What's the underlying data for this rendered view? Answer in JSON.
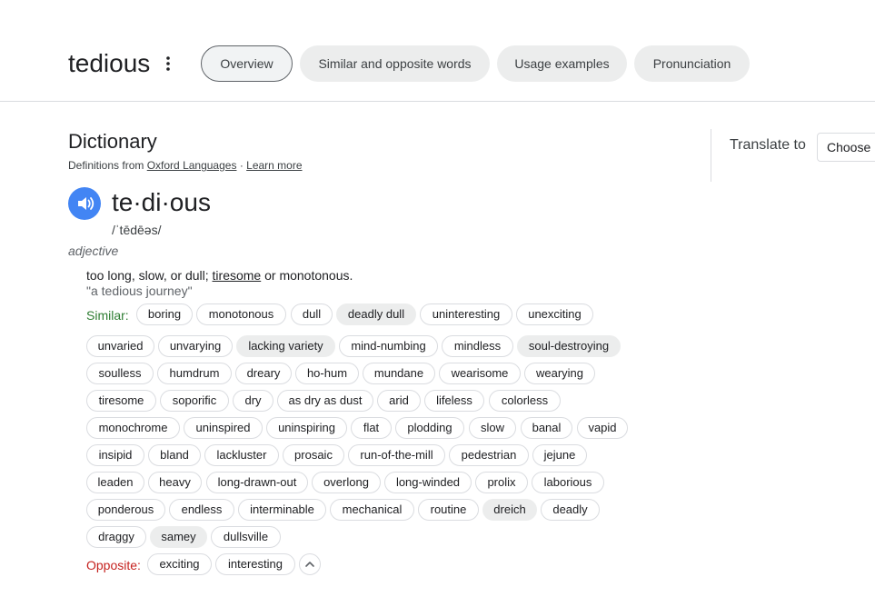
{
  "header": {
    "word": "tedious",
    "tabs": [
      {
        "label": "Overview"
      },
      {
        "label": "Similar and opposite words"
      },
      {
        "label": "Usage examples"
      },
      {
        "label": "Pronunciation"
      }
    ],
    "more_icon": "more-vert-icon"
  },
  "dictionary": {
    "heading": "Dictionary",
    "source_prefix": "Definitions from",
    "source_link": "Oxford Languages",
    "separator": "·",
    "learn_more": "Learn more"
  },
  "translate": {
    "label": "Translate to",
    "select_value": "Choose"
  },
  "entry": {
    "audio_icon": "speaker-icon",
    "headword": "te·di·ous",
    "phonetic": "/ˈtēdēəs/",
    "part_of_speech": "adjective",
    "definition_before": "too long, slow, or dull; ",
    "definition_link": "tiresome",
    "definition_after": " or monotonous.",
    "example": "\"a tedious journey\"",
    "similar_label": "Similar:",
    "similar": [
      {
        "word": "boring"
      },
      {
        "word": "monotonous"
      },
      {
        "word": "dull"
      },
      {
        "word": "deadly dull"
      },
      {
        "word": "uninteresting"
      },
      {
        "word": "unexciting"
      },
      {
        "word": "unvaried"
      },
      {
        "word": "unvarying"
      },
      {
        "word": "lacking variety"
      },
      {
        "word": "mind-numbing"
      },
      {
        "word": "mindless"
      },
      {
        "word": "soul-destroying"
      },
      {
        "word": "soulless"
      },
      {
        "word": "humdrum"
      },
      {
        "word": "dreary"
      },
      {
        "word": "ho-hum"
      },
      {
        "word": "mundane"
      },
      {
        "word": "wearisome"
      },
      {
        "word": "wearying"
      },
      {
        "word": "tiresome"
      },
      {
        "word": "soporific"
      },
      {
        "word": "dry"
      },
      {
        "word": "as dry as dust"
      },
      {
        "word": "arid"
      },
      {
        "word": "lifeless"
      },
      {
        "word": "colorless"
      },
      {
        "word": "monochrome"
      },
      {
        "word": "uninspired"
      },
      {
        "word": "uninspiring"
      },
      {
        "word": "flat"
      },
      {
        "word": "plodding"
      },
      {
        "word": "slow"
      },
      {
        "word": "banal"
      },
      {
        "word": "vapid"
      },
      {
        "word": "insipid"
      },
      {
        "word": "bland"
      },
      {
        "word": "lackluster"
      },
      {
        "word": "prosaic"
      },
      {
        "word": "run-of-the-mill"
      },
      {
        "word": "pedestrian"
      },
      {
        "word": "jejune"
      },
      {
        "word": "leaden"
      },
      {
        "word": "heavy"
      },
      {
        "word": "long-drawn-out"
      },
      {
        "word": "overlong"
      },
      {
        "word": "long-winded"
      },
      {
        "word": "prolix"
      },
      {
        "word": "laborious"
      },
      {
        "word": "ponderous"
      },
      {
        "word": "endless"
      },
      {
        "word": "interminable"
      },
      {
        "word": "mechanical"
      },
      {
        "word": "routine"
      },
      {
        "word": "dreich"
      },
      {
        "word": "deadly"
      },
      {
        "word": "draggy"
      },
      {
        "word": "samey"
      },
      {
        "word": "dullsville"
      }
    ],
    "opposite_label": "Opposite:",
    "opposite": [
      {
        "word": "exciting"
      },
      {
        "word": "interesting"
      }
    ],
    "collapse_icon": "chevron-up-icon"
  },
  "colors": {
    "accent_blue": "#4285f4",
    "similar_green": "#2e7d32",
    "opposite_red": "#c5221f"
  }
}
